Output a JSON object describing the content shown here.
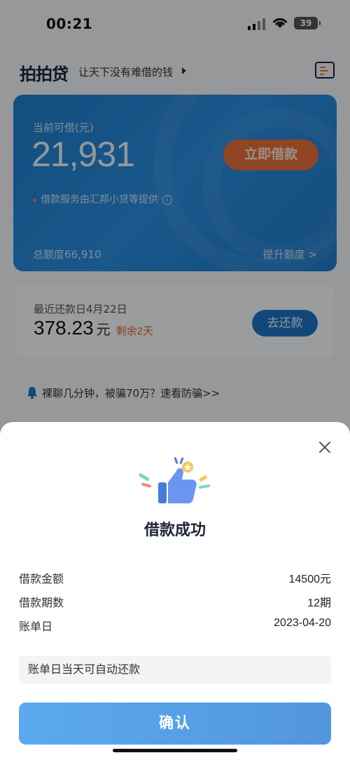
{
  "status_bar": {
    "time": "00:21",
    "battery": "39"
  },
  "header": {
    "logo": "拍拍贷",
    "slogan": "让天下没有难借的钱"
  },
  "credit_card": {
    "label": "当前可借(元)",
    "amount": "21,931",
    "borrow_button": "立即借款",
    "provider_note": "借款服务由汇邦小贷等提供",
    "total_limit": "总额度66,910",
    "raise_limit": "提升额度 >"
  },
  "repayment": {
    "label": "最近还款日4月22日",
    "amount": "378.23",
    "unit": "元",
    "remaining": "剩余2天",
    "button": "去还款"
  },
  "notice": {
    "text": "裸聊几分钟，被骗70万？速看防骗>>"
  },
  "dialog": {
    "title": "借款成功",
    "details": [
      {
        "label": "借款金额",
        "value": "14500元"
      },
      {
        "label": "借款期数",
        "value": "12期"
      },
      {
        "label": "账单日",
        "value": "2023-04-20"
      }
    ],
    "tip": "账单日当天可自动还款",
    "confirm_button": "确认"
  },
  "colors": {
    "primary": "#2a8ee0",
    "accent": "#e8703a",
    "confirm": "#5ca9f0"
  }
}
